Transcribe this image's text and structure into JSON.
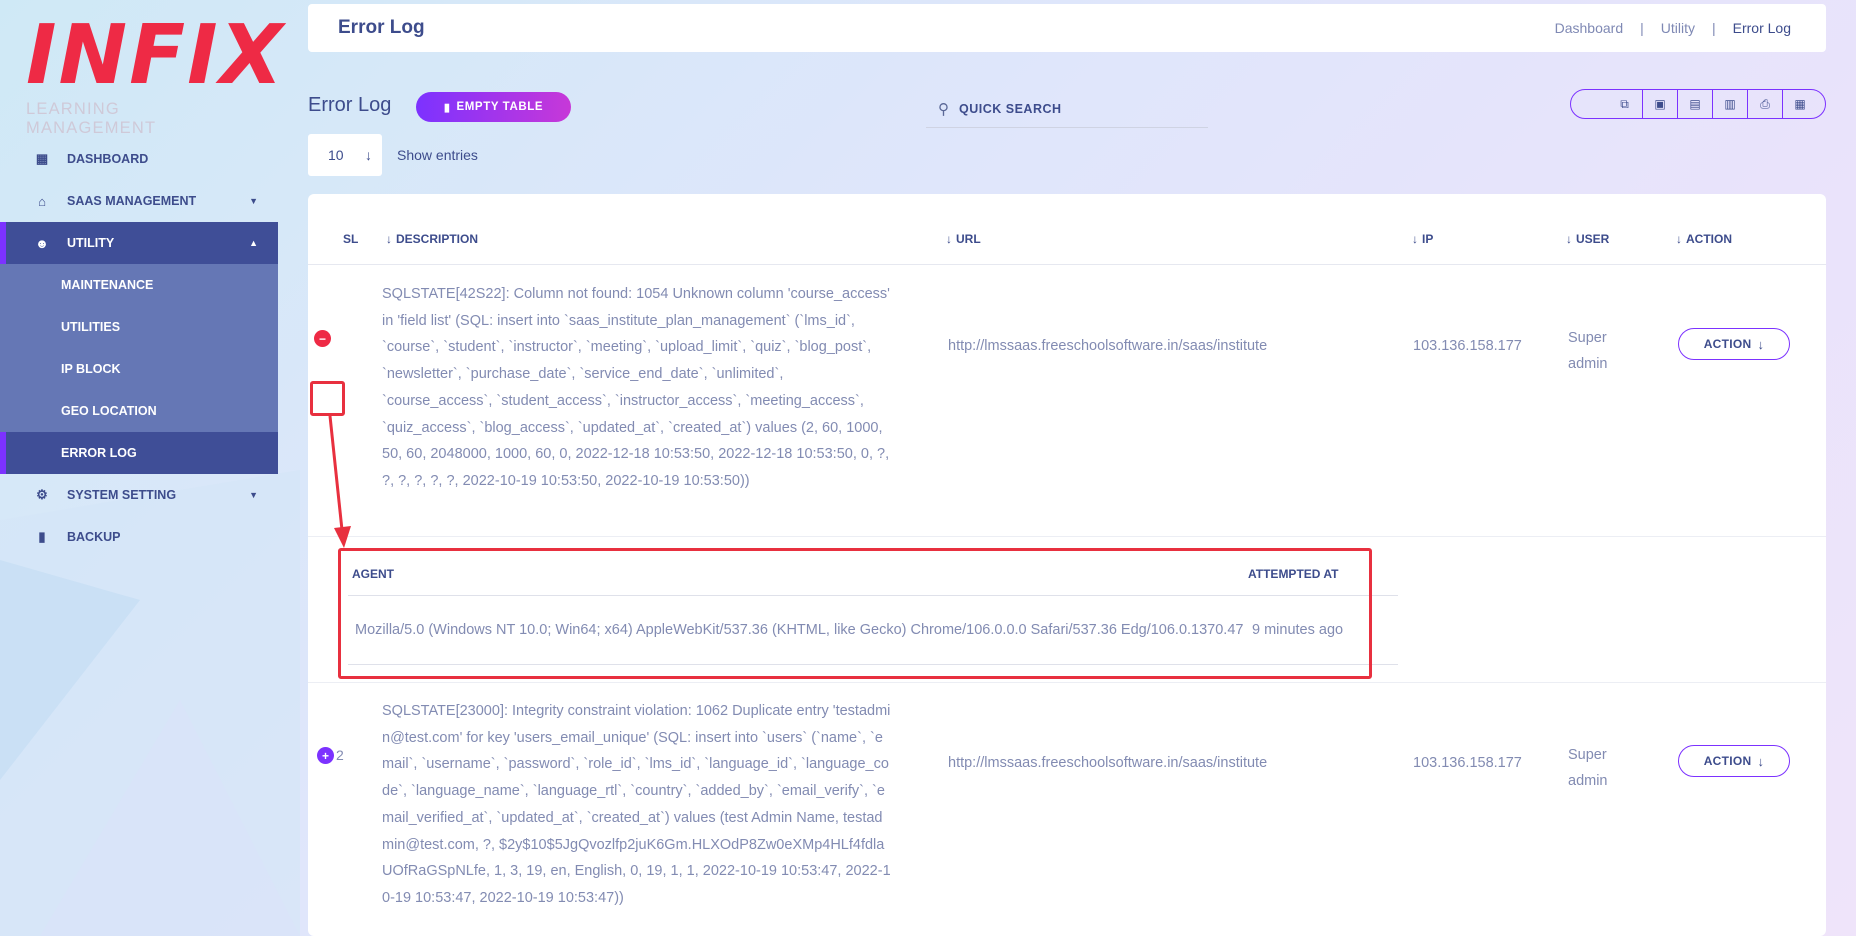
{
  "sidebar": {
    "logo_text": "INFIX",
    "logo_subtitle": "LEARNING MANAGEMENT",
    "items": [
      {
        "label": "DASHBOARD",
        "icon": "grid-icon"
      },
      {
        "label": "SAAS MANAGEMENT",
        "icon": "bank-icon"
      },
      {
        "label": "UTILITY",
        "icon": "user-gear-icon"
      },
      {
        "label": "SYSTEM SETTING",
        "icon": "gears-icon"
      },
      {
        "label": "BACKUP",
        "icon": "file-icon"
      }
    ],
    "utility_sub": [
      {
        "label": "MAINTENANCE"
      },
      {
        "label": "UTILITIES"
      },
      {
        "label": "IP BLOCK"
      },
      {
        "label": "GEO LOCATION"
      },
      {
        "label": "ERROR LOG"
      }
    ]
  },
  "header": {
    "title": "Error Log",
    "breadcrumb": [
      "Dashboard",
      "Utility",
      "Error Log"
    ],
    "separator": "|"
  },
  "toolbar": {
    "section_title": "Error Log",
    "empty_table_label": "EMPTY TABLE",
    "search_placeholder": "QUICK SEARCH",
    "export_buttons": [
      "copy-icon",
      "excel-icon",
      "csv-icon",
      "pdf-icon",
      "print-icon",
      "columns-icon"
    ],
    "entries_value": "10",
    "entries_label": "Show entries"
  },
  "table": {
    "columns": [
      "SL",
      "DESCRIPTION",
      "URL",
      "IP",
      "USER",
      "ACTION"
    ],
    "rows": [
      {
        "sl": "",
        "description": "SQLSTATE[42S22]: Column not found: 1054 Unknown column 'course_access' in 'field list' (SQL: insert into `saas_institute_plan_management` (`lms_id`, `course`, `student`, `instructor`, `meeting`, `upload_limit`, `quiz`, `blog_post`, `newsletter`, `purchase_date`, `service_end_date`, `unlimited`, `course_access`, `student_access`, `instructor_access`, `meeting_access`, `quiz_access`, `blog_access`, `updated_at`, `created_at`) values (2, 60, 1000, 50, 60, 2048000, 1000, 60, 0, 2022-12-18 10:53:50, 2022-12-18 10:53:50, 0, ?, ?, ?, ?, ?, ?, 2022-10-19 10:53:50, 2022-10-19 10:53:50))",
        "url": "http://lmssaas.freeschoolsoftware.in/saas/institute",
        "ip": "103.136.158.177",
        "user": "Super admin",
        "action_label": "ACTION",
        "expanded": true,
        "child": {
          "agent_header": "AGENT",
          "attempted_header": "ATTEMPTED AT",
          "agent": "Mozilla/5.0 (Windows NT 10.0; Win64; x64) AppleWebKit/537.36 (KHTML, like Gecko) Chrome/106.0.0.0 Safari/537.36 Edg/106.0.1370.47",
          "attempted_at": "9 minutes ago"
        }
      },
      {
        "sl": "2",
        "description": "SQLSTATE[23000]: Integrity constraint violation: 1062 Duplicate entry 'testadmin@test.com' for key 'users_email_unique' (SQL: insert into `users` (`name`, `email`, `username`, `password`, `role_id`, `lms_id`, `language_id`, `language_code`, `language_name`, `language_rtl`, `country`, `added_by`, `email_verify`, `email_verified_at`, `updated_at`, `created_at`) values (test Admin Name, testadmin@test.com, ?, $2y$10$5JgQvozlfp2juK6Gm.HLXOdP8Zw0eXMp4HLf4fdlaUOfRaGSpNLfe, 1, 3, 19, en, English, 0, 19, 1, 1, 2022-10-19 10:53:47, 2022-10-19 10:53:47, 2022-10-19 10:53:47))",
        "url": "http://lmssaas.freeschoolsoftware.in/saas/institute",
        "ip": "103.136.158.177",
        "user": "Super admin",
        "action_label": "ACTION",
        "expanded": false
      }
    ]
  },
  "colors": {
    "primary": "#7c32ff",
    "navy": "#415094",
    "danger": "#ee2a45",
    "highlight": "#e8303f"
  }
}
